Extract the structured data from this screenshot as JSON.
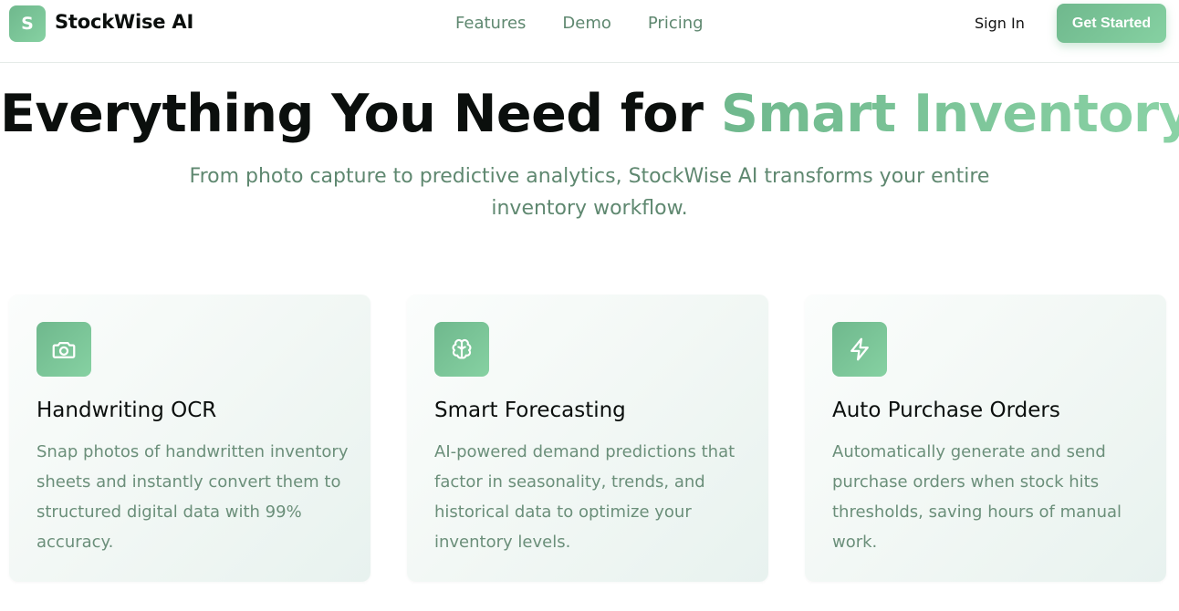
{
  "brand": {
    "logo_letter": "S",
    "name": "StockWise AI"
  },
  "nav": {
    "links": [
      "Features",
      "Demo",
      "Pricing"
    ],
    "sign_in": "Sign In",
    "cta": "Get Started"
  },
  "hero": {
    "title_plain": "Everything You Need for ",
    "title_accent": "Smart Inventory",
    "subtitle": "From photo capture to predictive analytics, StockWise AI transforms your entire inventory workflow."
  },
  "features": [
    {
      "icon": "camera-icon",
      "title": "Handwriting OCR",
      "description": "Snap photos of handwritten inventory sheets and instantly convert them to structured digital data with 99% accuracy."
    },
    {
      "icon": "brain-icon",
      "title": "Smart Forecasting",
      "description": "AI-powered demand predictions that factor in seasonality, trends, and historical data to optimize your inventory levels."
    },
    {
      "icon": "lightning-icon",
      "title": "Auto Purchase Orders",
      "description": "Automatically generate and send purchase orders when stock hits thresholds, saving hours of manual work."
    }
  ],
  "colors": {
    "accent_start": "#6fb88d",
    "accent_end": "#86d1a2",
    "muted_text": "#5f8870"
  }
}
